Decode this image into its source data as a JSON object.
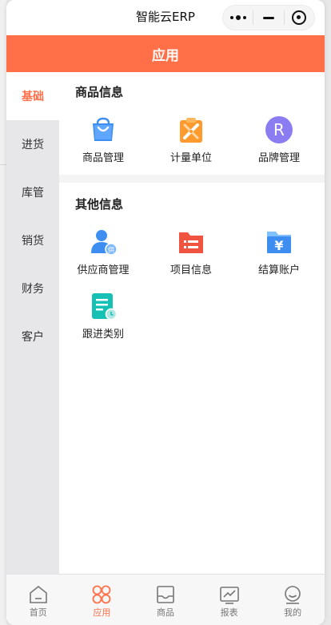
{
  "topbar": {
    "app_title": "智能云ERP"
  },
  "header": {
    "title": "应用"
  },
  "colors": {
    "accent": "#ff6f48",
    "sidebar_bg": "#e7e7ea"
  },
  "sidebar": {
    "items": [
      {
        "label": "基础",
        "active": true
      },
      {
        "label": "进货"
      },
      {
        "label": "库管"
      },
      {
        "label": "销货"
      },
      {
        "label": "财务"
      },
      {
        "label": "客户"
      }
    ]
  },
  "sections": [
    {
      "title": "商品信息",
      "items": [
        {
          "label": "商品管理",
          "icon": "shopping-bag-icon"
        },
        {
          "label": "计量单位",
          "icon": "ruler-clipboard-icon"
        },
        {
          "label": "品牌管理",
          "icon": "registered-brand-icon"
        }
      ]
    },
    {
      "title": "其他信息",
      "items": [
        {
          "label": "供应商管理",
          "icon": "supplier-user-icon",
          "badge": "供"
        },
        {
          "label": "项目信息",
          "icon": "project-folder-icon"
        },
        {
          "label": "结算账户",
          "icon": "yen-folder-icon",
          "symbol": "¥"
        },
        {
          "label": "跟进类别",
          "icon": "followup-document-icon"
        }
      ]
    }
  ],
  "tabbar": {
    "items": [
      {
        "label": "首页",
        "icon": "home-icon"
      },
      {
        "label": "应用",
        "icon": "apps-icon",
        "active": true
      },
      {
        "label": "商品",
        "icon": "inbox-icon"
      },
      {
        "label": "报表",
        "icon": "chart-icon"
      },
      {
        "label": "我的",
        "icon": "profile-icon"
      }
    ]
  }
}
